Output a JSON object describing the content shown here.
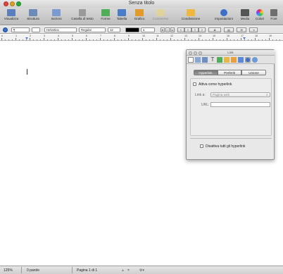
{
  "window": {
    "title": "Senza titolo"
  },
  "toolbar": {
    "items": [
      {
        "label": "Visualizza",
        "icon": "view-icon",
        "color": "#5b7fbd",
        "dim": false
      },
      {
        "label": "Struttura",
        "icon": "sections-icon",
        "color": "#6b8bb8",
        "dim": false
      },
      {
        "label": "Sezioni",
        "icon": "section-layout-icon",
        "color": "#7b9bd0",
        "dim": false
      },
      {
        "label": "Casella di testo",
        "icon": "text-box-icon",
        "color": "#9a9a9a",
        "dim": false
      },
      {
        "label": "Forme",
        "icon": "shapes-icon",
        "color": "#4fae57",
        "dim": false
      },
      {
        "label": "Tabella",
        "icon": "table-icon",
        "color": "#4a7cc7",
        "dim": false
      },
      {
        "label": "Grafico",
        "icon": "chart-icon",
        "color": "#e39a2c",
        "dim": false
      },
      {
        "label": "Commento",
        "icon": "comment-icon",
        "color": "#e9d47c",
        "dim": true
      },
      {
        "label": "Condivisione",
        "icon": "share-icon",
        "color": "#f0b840",
        "dim": false
      },
      {
        "label": "Impostazioni",
        "icon": "inspector-icon",
        "color": "#3d6fc9",
        "dim": false
      },
      {
        "label": "Media",
        "icon": "media-icon",
        "color": "#555555",
        "dim": false
      },
      {
        "label": "Colori",
        "icon": "colors-icon",
        "color": "#d8468e",
        "dim": false
      },
      {
        "label": "Font",
        "icon": "fonts-icon",
        "color": "#6f6f6f",
        "dim": false
      }
    ]
  },
  "formatbar": {
    "style": "¶",
    "font_family": "Helvetica",
    "font_style": "Regular",
    "font_size": "12",
    "line_spacing": "a"
  },
  "ruler": {
    "numbers": [
      "0",
      "1",
      "2",
      "3",
      "4",
      "5",
      "6",
      "7",
      "8",
      "9",
      "10",
      "11",
      "12",
      "13",
      "14",
      "15",
      "16",
      "17",
      "18",
      "19"
    ]
  },
  "status": {
    "zoom": "125%",
    "words": "0 parole",
    "page": "Pagina 1 di 1"
  },
  "inspector": {
    "title": "Link",
    "tabs": [
      "Hyperlink",
      "Preferiti",
      "Unione"
    ],
    "selected_tab": "Hyperlink",
    "enable_label": "Attiva come hyperlink",
    "link_label": "Link a:",
    "link_value": "Pagina web",
    "url_label": "URL:",
    "url_value": "",
    "disable_all_label": "Disattiva tutti gli hyperlink"
  }
}
